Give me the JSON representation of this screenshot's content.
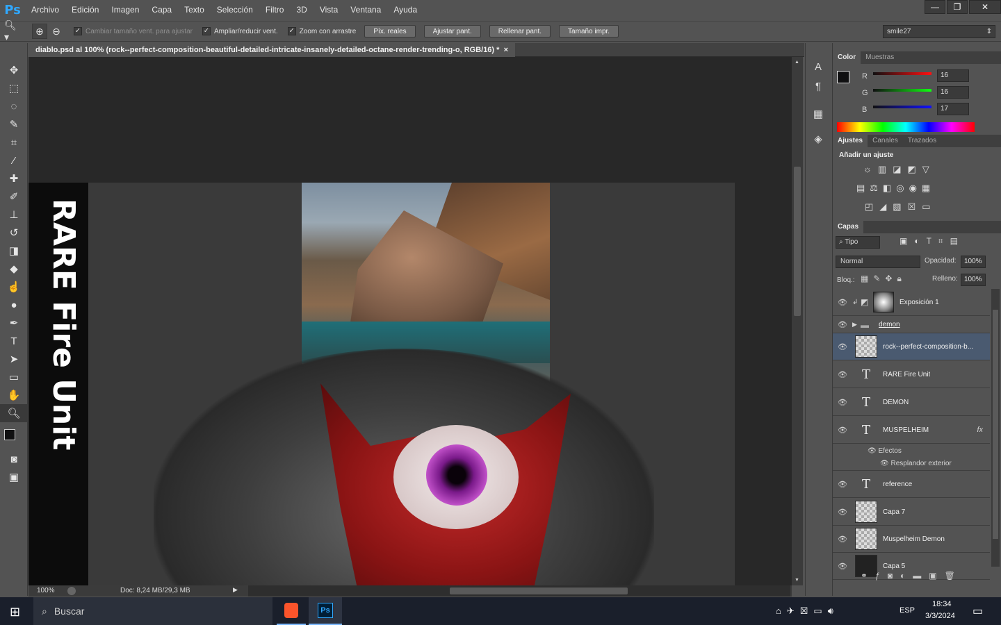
{
  "app": {
    "logo": "Ps"
  },
  "menu": [
    "Archivo",
    "Edición",
    "Imagen",
    "Capa",
    "Texto",
    "Selección",
    "Filtro",
    "3D",
    "Vista",
    "Ventana",
    "Ayuda"
  ],
  "window_controls": {
    "minimize": "—",
    "restore": "❐",
    "close": "✕"
  },
  "options_bar": {
    "resize_window": "Cambiar tamaño vent. para ajustar",
    "zoom_all": "Ampliar/reducir vent.",
    "scrubby": "Zoom con arrastre",
    "buttons": [
      "Píx. reales",
      "Ajustar pant.",
      "Rellenar pant.",
      "Tamaño impr."
    ],
    "workspace": "smile27"
  },
  "document": {
    "tab_title": "diablo.psd al 100% (rock--perfect-composition-beautiful-detailed-intricate-insanely-detailed-octane-render-trending-o, RGB/16) *",
    "tab_close": "×",
    "rotated_text": "RARE Fire Unit",
    "zoom": "100%",
    "doc_info": "Doc: 8,24 MB/29,3 MB"
  },
  "color_panel": {
    "tabs": [
      "Color",
      "Muestras"
    ],
    "r": "16",
    "g": "16",
    "b": "17",
    "r_label": "R",
    "g_label": "G",
    "b_label": "B"
  },
  "adjust_panel": {
    "tabs": [
      "Ajustes",
      "Canales",
      "Trazados"
    ],
    "heading": "Añadir un ajuste"
  },
  "layers_panel": {
    "tab": "Capas",
    "filter": "Tipo",
    "blend_mode": "Normal",
    "opacity_label": "Opacidad:",
    "opacity": "100%",
    "lock_label": "Bloq.:",
    "fill_label": "Relleno:",
    "fill": "100%",
    "layers": [
      {
        "name": "Exposición 1",
        "kind": "adjustment"
      },
      {
        "name": "demon",
        "kind": "group"
      },
      {
        "name": "rock--perfect-composition-b...",
        "kind": "smart",
        "selected": true
      },
      {
        "name": "RARE Fire Unit",
        "kind": "text"
      },
      {
        "name": "DEMON",
        "kind": "text"
      },
      {
        "name": "MUSPELHEIM",
        "kind": "text",
        "fx": "fx"
      },
      {
        "name": "reference",
        "kind": "text"
      },
      {
        "name": "Capa 7",
        "kind": "pixel"
      },
      {
        "name": "Muspelheim Demon",
        "kind": "smart"
      },
      {
        "name": "Capa 5",
        "kind": "pixel"
      }
    ],
    "effects_label": "Efectos",
    "effect_name": "Resplandor exterior"
  },
  "taskbar": {
    "search": "Buscar",
    "lang": "ESP",
    "time": "18:34",
    "date": "3/3/2024"
  }
}
